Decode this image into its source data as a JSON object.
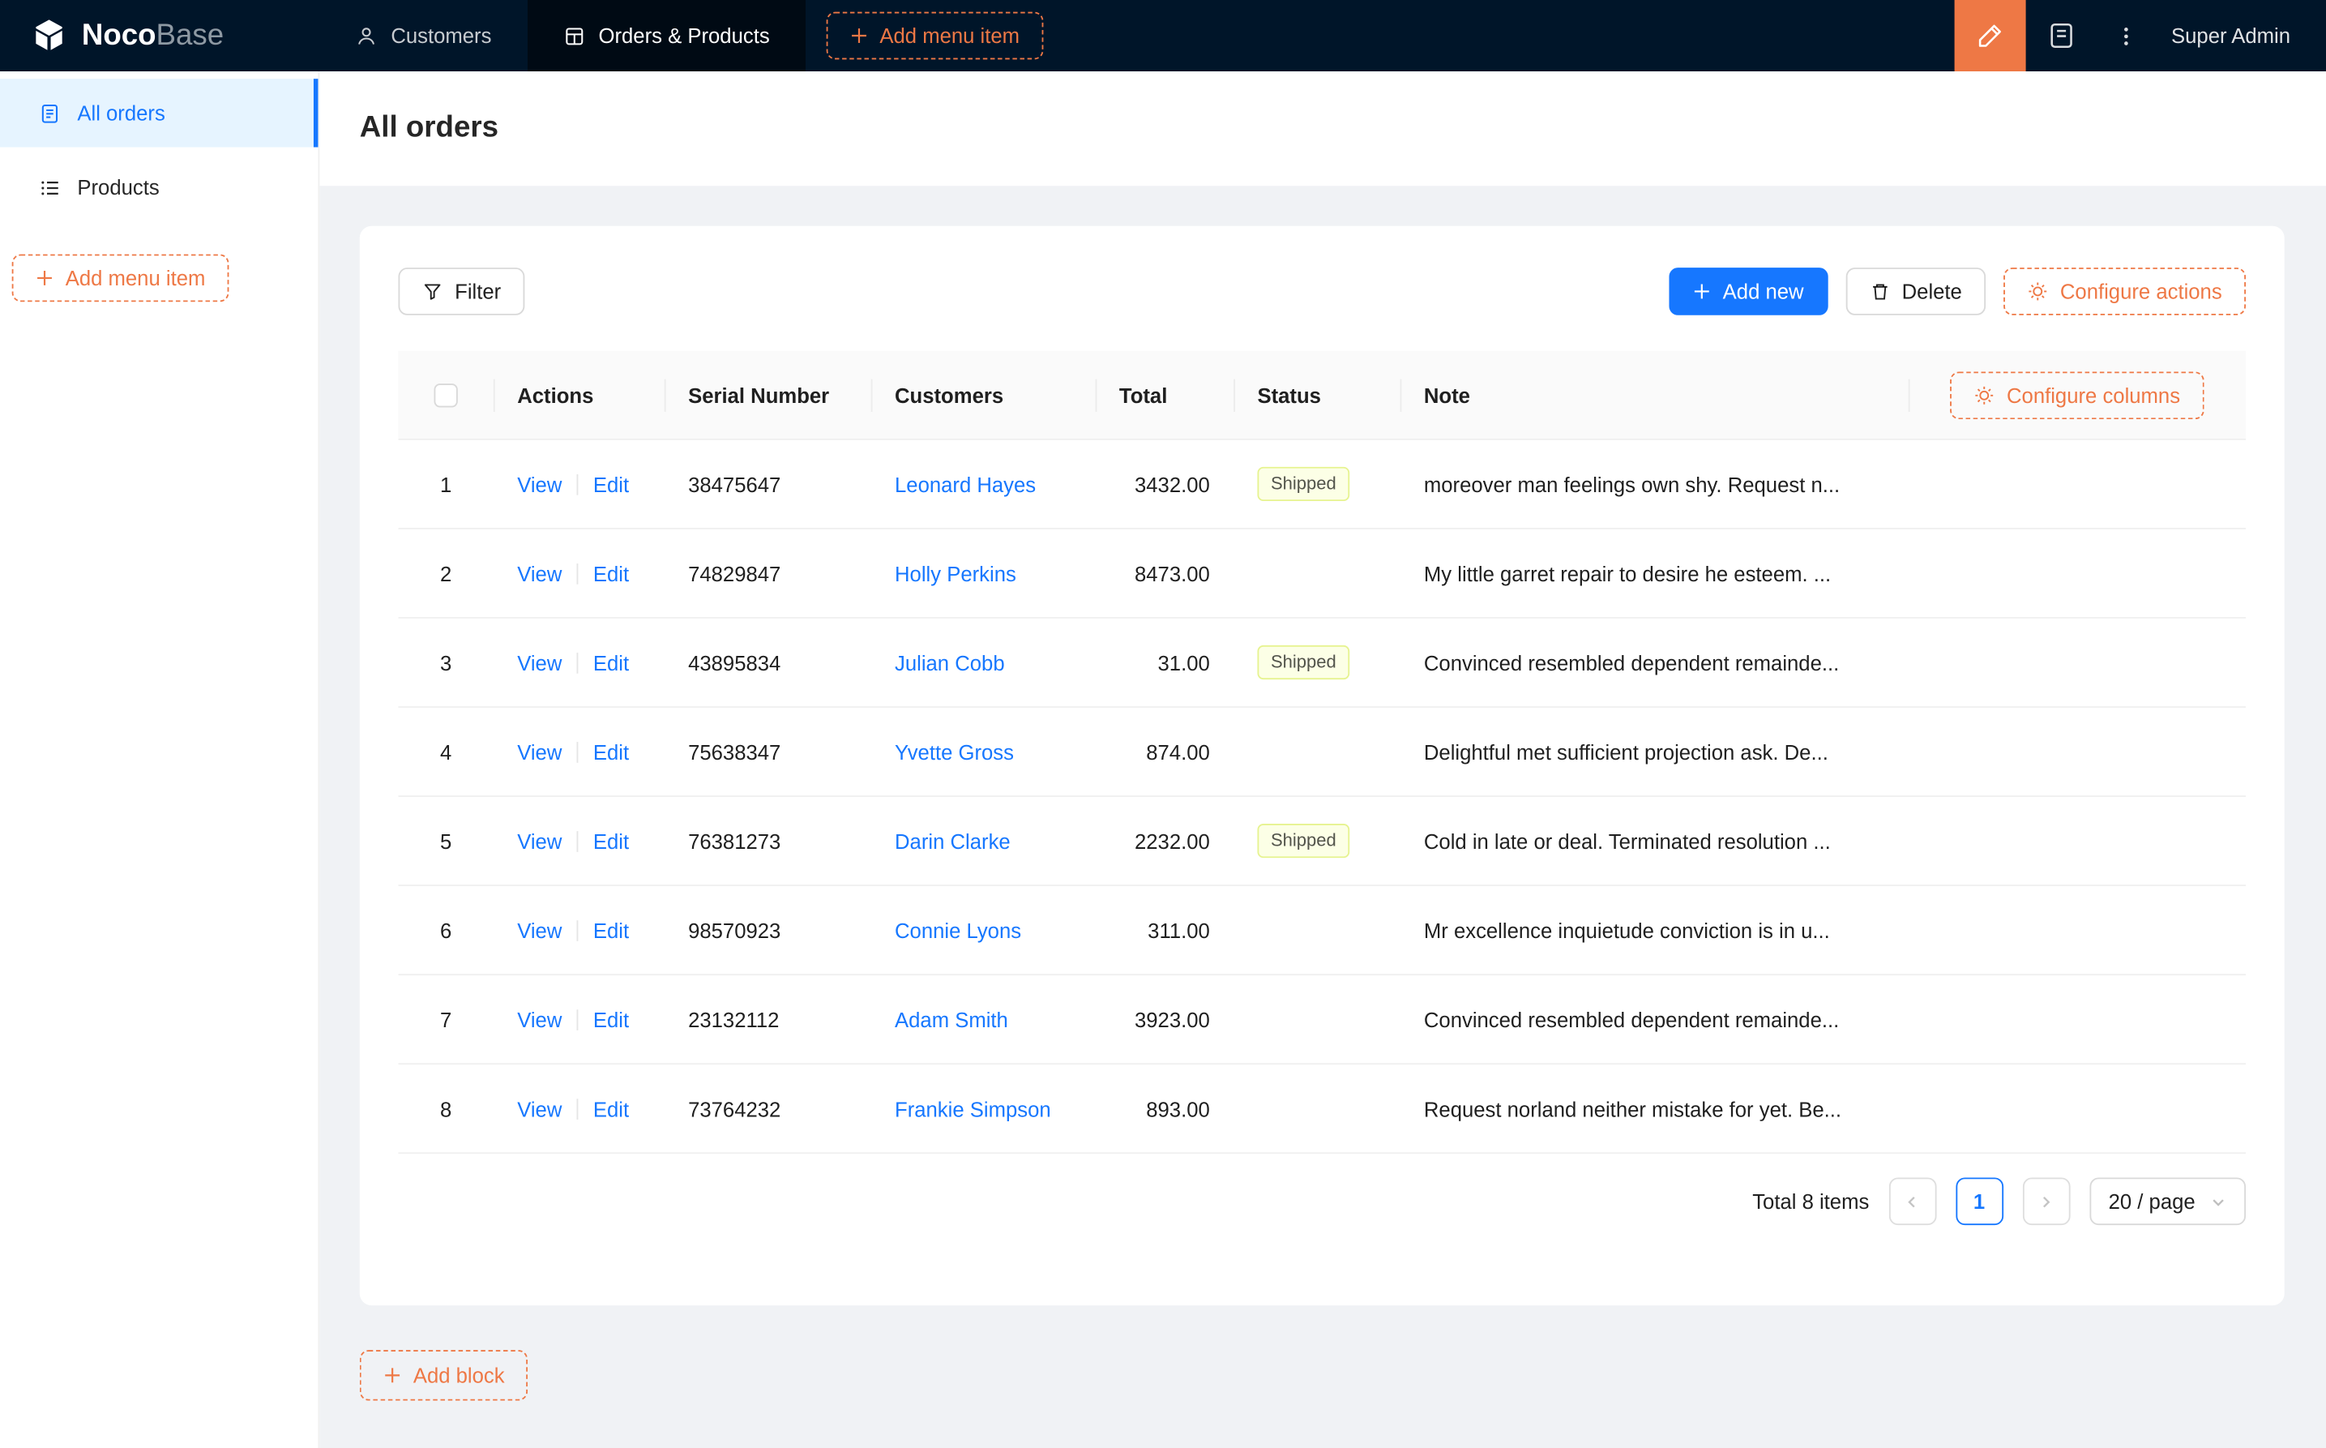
{
  "colors": {
    "accent": "#ee7845",
    "primary": "#1677ff",
    "topbar_bg": "#001529",
    "page_bg": "#f0f2f5",
    "tag_bg": "#fcffe6",
    "tag_border": "#e6f390"
  },
  "topbar": {
    "logo_noco": "Noco",
    "logo_base": "Base",
    "nav": [
      {
        "label": "Customers"
      },
      {
        "label": "Orders & Products"
      }
    ],
    "add_menu_item": "Add menu item",
    "user": "Super Admin"
  },
  "sidebar": {
    "items": [
      {
        "label": "All orders"
      },
      {
        "label": "Products"
      }
    ],
    "add_menu_item": "Add menu item"
  },
  "page": {
    "title": "All orders",
    "add_block": "Add block"
  },
  "toolbar": {
    "filter": "Filter",
    "add_new": "Add new",
    "delete": "Delete",
    "configure_actions": "Configure actions"
  },
  "table": {
    "configure_columns": "Configure columns",
    "headers": {
      "actions": "Actions",
      "serial": "Serial Number",
      "customers": "Customers",
      "total": "Total",
      "status": "Status",
      "note": "Note"
    },
    "action_labels": {
      "view": "View",
      "edit": "Edit"
    },
    "rows": [
      {
        "index": "1",
        "serial": "38475647",
        "customer": "Leonard Hayes",
        "total": "3432.00",
        "status": "Shipped",
        "note": "moreover man feelings own shy. Request n..."
      },
      {
        "index": "2",
        "serial": "74829847",
        "customer": "Holly Perkins",
        "total": "8473.00",
        "status": "",
        "note": "My little garret repair to desire he esteem. ..."
      },
      {
        "index": "3",
        "serial": "43895834",
        "customer": "Julian Cobb",
        "total": "31.00",
        "status": "Shipped",
        "note": "Convinced resembled dependent remainde..."
      },
      {
        "index": "4",
        "serial": "75638347",
        "customer": "Yvette Gross",
        "total": "874.00",
        "status": "",
        "note": "Delightful met sufficient projection ask. De..."
      },
      {
        "index": "5",
        "serial": "76381273",
        "customer": "Darin Clarke",
        "total": "2232.00",
        "status": "Shipped",
        "note": "Cold in late or deal. Terminated resolution ..."
      },
      {
        "index": "6",
        "serial": "98570923",
        "customer": "Connie Lyons",
        "total": "311.00",
        "status": "",
        "note": "Mr excellence inquietude conviction is in u..."
      },
      {
        "index": "7",
        "serial": "23132112",
        "customer": "Adam Smith",
        "total": "3923.00",
        "status": "",
        "note": "Convinced resembled dependent remainde..."
      },
      {
        "index": "8",
        "serial": "73764232",
        "customer": "Frankie Simpson",
        "total": "893.00",
        "status": "",
        "note": "Request norland neither mistake for yet. Be..."
      }
    ]
  },
  "pagination": {
    "total": "Total 8 items",
    "current": "1",
    "page_size": "20 / page"
  },
  "icons": {
    "nocobase-logo": "isometric cube",
    "users-icon": "person outline",
    "table-icon": "grid document",
    "plus-icon": "+",
    "design-mode-icon": "highlighter pen",
    "collections-icon": "notebook with lines",
    "ellipsis-icon": "vertical dots",
    "orders-icon": "document with lines",
    "list-icon": "bulleted list",
    "filter-icon": "funnel",
    "delete-icon": "trash can",
    "gear-icon": "gear",
    "chevron-left-icon": "‹",
    "chevron-right-icon": "›",
    "chevron-down-icon": "⌄"
  }
}
